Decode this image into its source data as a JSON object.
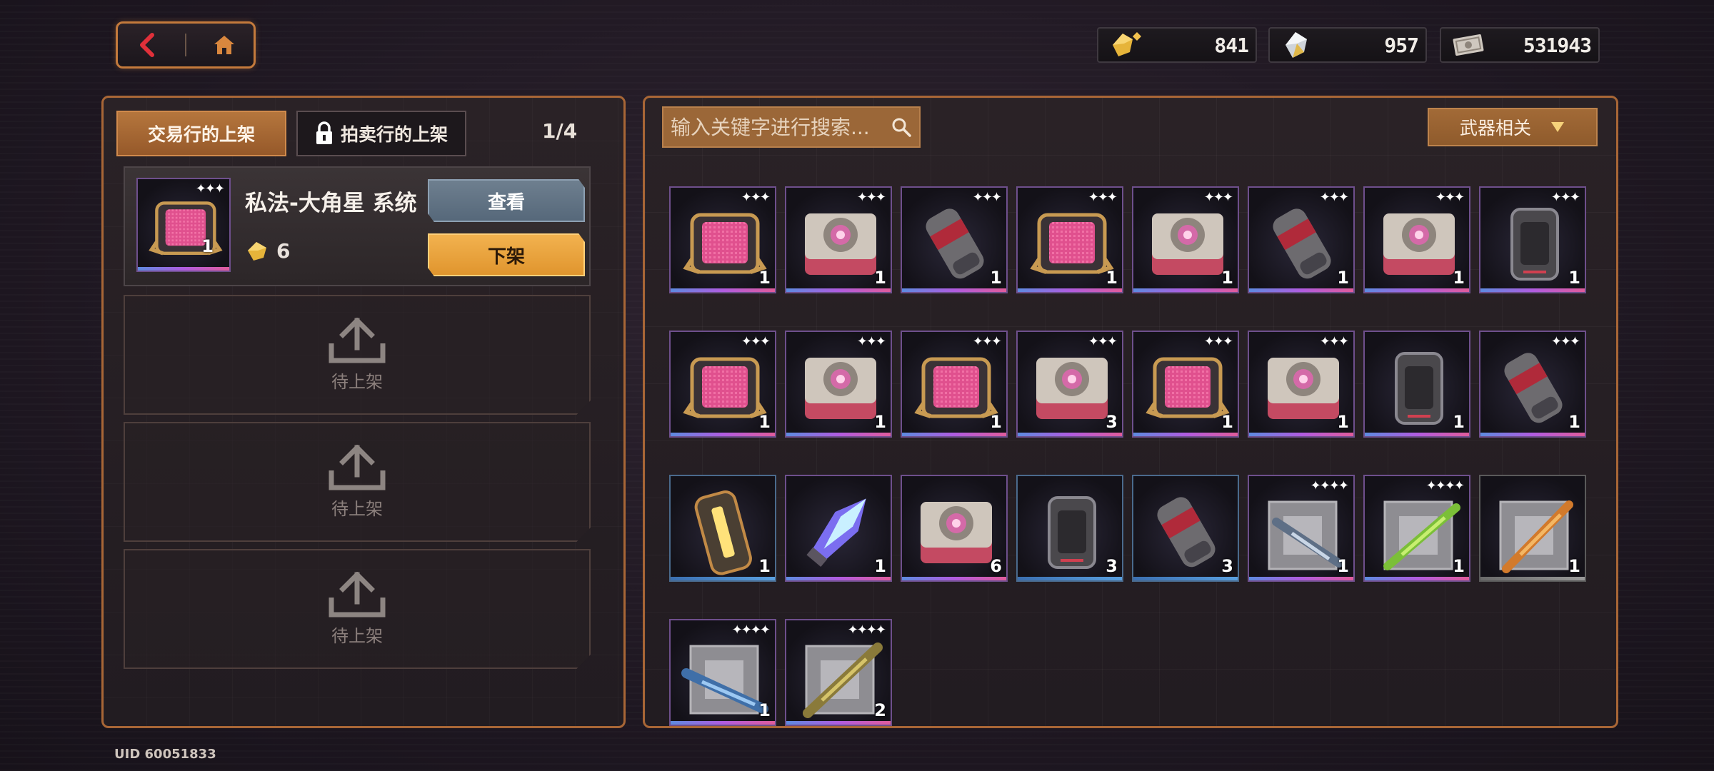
{
  "nav": {
    "back_icon": "chevron-left-icon",
    "home_icon": "home-icon"
  },
  "currencies": [
    {
      "icon": "gold-crystal-icon",
      "value": "841"
    },
    {
      "icon": "silver-crystal-icon",
      "value": "957"
    },
    {
      "icon": "banknote-icon",
      "value": "531943"
    }
  ],
  "left": {
    "tabs": {
      "exchange": "交易行的上架",
      "auction": "拍卖行的上架"
    },
    "page": "1/4",
    "listing": {
      "name": "私法-大角星 系统",
      "thumb_qty": "1",
      "price": "6",
      "view_label": "查看",
      "remove_label": "下架"
    },
    "slots": [
      {
        "label": "待上架"
      },
      {
        "label": "待上架"
      },
      {
        "label": "待上架"
      }
    ]
  },
  "right": {
    "search_placeholder": "输入关键字进行搜索...",
    "filter_label": "武器相关",
    "items": [
      {
        "kind": "chip",
        "qty": "1",
        "stars": "✦✦✦",
        "rarity": "purple"
      },
      {
        "kind": "gear",
        "qty": "1",
        "stars": "✦✦✦",
        "rarity": "purple"
      },
      {
        "kind": "canister",
        "qty": "1",
        "stars": "✦✦✦",
        "rarity": "purple"
      },
      {
        "kind": "chip",
        "qty": "1",
        "stars": "✦✦✦",
        "rarity": "purple"
      },
      {
        "kind": "gear",
        "qty": "1",
        "stars": "✦✦✦",
        "rarity": "purple"
      },
      {
        "kind": "canister",
        "qty": "1",
        "stars": "✦✦✦",
        "rarity": "purple"
      },
      {
        "kind": "gear",
        "qty": "1",
        "stars": "✦✦✦",
        "rarity": "purple"
      },
      {
        "kind": "barrel",
        "qty": "1",
        "stars": "✦✦✦",
        "rarity": "purple"
      },
      {
        "kind": "chip",
        "qty": "1",
        "stars": "✦✦✦",
        "rarity": "purple"
      },
      {
        "kind": "gear",
        "qty": "1",
        "stars": "✦✦✦",
        "rarity": "purple"
      },
      {
        "kind": "chip",
        "qty": "1",
        "stars": "✦✦✦",
        "rarity": "purple"
      },
      {
        "kind": "gear",
        "qty": "3",
        "stars": "✦✦✦",
        "rarity": "purple"
      },
      {
        "kind": "chip",
        "qty": "1",
        "stars": "✦✦✦",
        "rarity": "purple"
      },
      {
        "kind": "gear",
        "qty": "1",
        "stars": "✦✦✦",
        "rarity": "purple"
      },
      {
        "kind": "barrel",
        "qty": "1",
        "stars": "",
        "rarity": "purple"
      },
      {
        "kind": "canister",
        "qty": "1",
        "stars": "✦✦✦",
        "rarity": "purple"
      },
      {
        "kind": "battery",
        "qty": "1",
        "stars": "",
        "rarity": "blue"
      },
      {
        "kind": "crystal",
        "qty": "1",
        "stars": "",
        "rarity": "purple"
      },
      {
        "kind": "gear",
        "qty": "6",
        "stars": "",
        "rarity": "purple"
      },
      {
        "kind": "barrel",
        "qty": "3",
        "stars": "",
        "rarity": "blue"
      },
      {
        "kind": "canister",
        "qty": "3",
        "stars": "",
        "rarity": "blue"
      },
      {
        "kind": "rifle",
        "qty": "1",
        "stars": "✦✦✦✦",
        "rarity": "purple"
      },
      {
        "kind": "rifle-green",
        "qty": "1",
        "stars": "✦✦✦✦",
        "rarity": "purple"
      },
      {
        "kind": "rifle-orange",
        "qty": "1",
        "stars": "",
        "rarity": "gray"
      },
      {
        "kind": "rifle-blue",
        "qty": "1",
        "stars": "✦✦✦✦",
        "rarity": "purple"
      },
      {
        "kind": "rifle-olive",
        "qty": "2",
        "stars": "✦✦✦✦",
        "rarity": "purple"
      }
    ]
  },
  "uid": "UID 60051833",
  "colors": {
    "accent": "#c47a3c",
    "purple_rarity": "#9b5cd6",
    "blue_rarity": "#4f8fd0",
    "remove_btn": "#f0a93f",
    "view_btn": "#6a7c8e"
  }
}
